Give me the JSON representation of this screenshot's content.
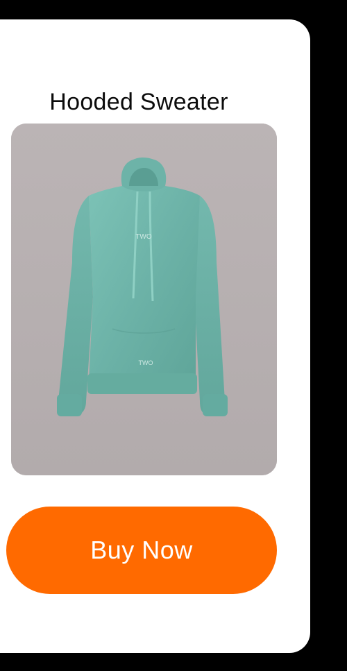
{
  "product": {
    "title": "Hooded Sweater",
    "image_icon": "hoodie-product-photo",
    "logo_chest": "TWO",
    "logo_hem": "TWO"
  },
  "actions": {
    "buy_label": "Buy Now"
  },
  "colors": {
    "background": "#000000",
    "card": "#ffffff",
    "accent": "#ff6a00",
    "photo_backdrop": "#b6afb0",
    "garment": "#6fb6ab"
  }
}
